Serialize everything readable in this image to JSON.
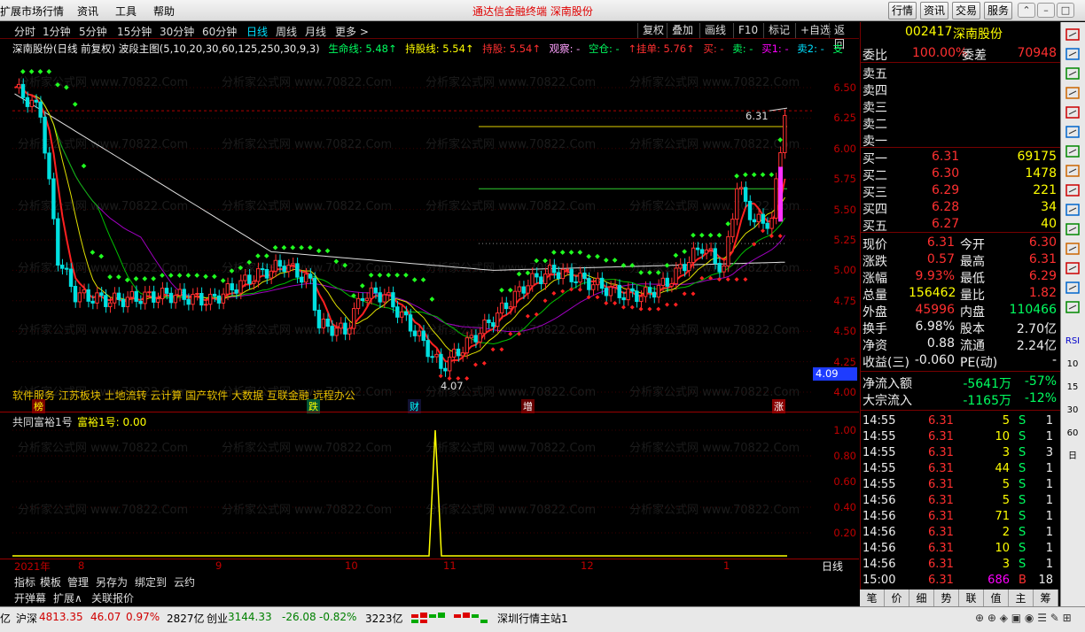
{
  "menu": {
    "items": [
      "扩展市场行情",
      "资讯",
      "工具",
      "帮助"
    ],
    "title": "通达信金融终端   深南股份",
    "right_buttons": [
      "行情",
      "资讯",
      "交易",
      "服务"
    ]
  },
  "period_bar": {
    "periods": [
      "分时",
      "1分钟",
      "5分钟",
      "15分钟",
      "30分钟",
      "60分钟",
      "日线",
      "周线",
      "月线",
      "更多 >"
    ],
    "active": "日线",
    "tools": [
      "复权",
      "叠加",
      "画线",
      "F10",
      "标记",
      "+自选",
      "返回"
    ]
  },
  "indicator_line": {
    "name": "深南股份(日线 前复权) 波段主图(5,10,20,30,60,125,250,30,9,3)",
    "life": "生命线: 5.48↑",
    "hold": "持股线: 5.54↑",
    "stop": "持股: 5.54↑",
    "watch": "观察: -",
    "empty": "空仓: -",
    "order": "↑挂单: 5.76↑",
    "buy": "买: -",
    "sell": "卖: -",
    "buy1": "买1: -",
    "sell2": "卖2: -",
    "support": "支"
  },
  "price_axis": {
    "labels": [
      "6.50",
      "6.25",
      "6.00",
      "5.75",
      "5.50",
      "5.25",
      "5.00",
      "4.75",
      "4.50",
      "4.25",
      "4.00"
    ],
    "current_tag": "4.09"
  },
  "annotations": {
    "high_label": "6.31",
    "low_label": "4.07",
    "concepts": "软件服务 江苏板块 土地流转 云计算 国产软件 大数据 互联金融 远程办公",
    "markers": [
      "榜",
      "跌",
      "财",
      "增",
      "涨"
    ]
  },
  "sub_chart": {
    "title": "共同富裕1号",
    "value": "富裕1号: 0.00",
    "y_labels": [
      "1.00",
      "0.80",
      "0.60",
      "0.40",
      "0.20"
    ]
  },
  "date_axis": {
    "labels": [
      "2021年",
      "8",
      "9",
      "10",
      "11",
      "12",
      "1"
    ],
    "period_label": "日线"
  },
  "bottom_tabs": [
    "指标",
    "模板",
    "管理",
    "另存为",
    "绑定到",
    "云约"
  ],
  "bottom_tabs2": [
    "开弹幕",
    "扩展∧",
    "关联报价"
  ],
  "stock": {
    "code": "002417",
    "name": "深南股份",
    "weibi_label": "委比",
    "weibi": "100.00%",
    "weicha_label": "委差",
    "weicha": "70948",
    "sell_levels": [
      {
        "label": "卖五",
        "price": "",
        "vol": ""
      },
      {
        "label": "卖四",
        "price": "",
        "vol": ""
      },
      {
        "label": "卖三",
        "price": "",
        "vol": ""
      },
      {
        "label": "卖二",
        "price": "",
        "vol": ""
      },
      {
        "label": "卖一",
        "price": "",
        "vol": ""
      }
    ],
    "buy_levels": [
      {
        "label": "买一",
        "price": "6.31",
        "vol": "69175"
      },
      {
        "label": "买二",
        "price": "6.30",
        "vol": "1478"
      },
      {
        "label": "买三",
        "price": "6.29",
        "vol": "221"
      },
      {
        "label": "买四",
        "price": "6.28",
        "vol": "34"
      },
      {
        "label": "买五",
        "price": "6.27",
        "vol": "40"
      }
    ],
    "stats": [
      {
        "l1": "现价",
        "v1": "6.31",
        "c1": "red",
        "l2": "今开",
        "v2": "6.30",
        "c2": "red"
      },
      {
        "l1": "涨跌",
        "v1": "0.57",
        "c1": "red",
        "l2": "最高",
        "v2": "6.31",
        "c2": "red"
      },
      {
        "l1": "涨幅",
        "v1": "9.93%",
        "c1": "red",
        "l2": "最低",
        "v2": "6.29",
        "c2": "red"
      },
      {
        "l1": "总量",
        "v1": "156462",
        "c1": "yellow",
        "l2": "量比",
        "v2": "1.82",
        "c2": "red"
      },
      {
        "l1": "外盘",
        "v1": "45996",
        "c1": "red",
        "l2": "内盘",
        "v2": "110466",
        "c2": "green"
      },
      {
        "l1": "换手",
        "v1": "6.98%",
        "c1": "white",
        "l2": "股本",
        "v2": "2.70亿",
        "c2": "white"
      },
      {
        "l1": "净资",
        "v1": "0.88",
        "c1": "white",
        "l2": "流通",
        "v2": "2.24亿",
        "c2": "white"
      },
      {
        "l1": "收益(三)",
        "v1": "-0.060",
        "c1": "white",
        "l2": "PE(动)",
        "v2": "-",
        "c2": "white"
      }
    ],
    "flow": [
      {
        "label": "净流入额",
        "v1": "-5641万",
        "v2": "-57%"
      },
      {
        "label": "大宗流入",
        "v1": "-1165万",
        "v2": "-12%"
      }
    ]
  },
  "ticks": [
    {
      "t": "14:55",
      "p": "6.31",
      "v": "5",
      "s": "S",
      "n": "1"
    },
    {
      "t": "14:55",
      "p": "6.31",
      "v": "10",
      "s": "S",
      "n": "1"
    },
    {
      "t": "14:55",
      "p": "6.31",
      "v": "3",
      "s": "S",
      "n": "3"
    },
    {
      "t": "14:55",
      "p": "6.31",
      "v": "44",
      "s": "S",
      "n": "1"
    },
    {
      "t": "14:55",
      "p": "6.31",
      "v": "5",
      "s": "S",
      "n": "1"
    },
    {
      "t": "14:56",
      "p": "6.31",
      "v": "5",
      "s": "S",
      "n": "1"
    },
    {
      "t": "14:56",
      "p": "6.31",
      "v": "71",
      "s": "S",
      "n": "1"
    },
    {
      "t": "14:56",
      "p": "6.31",
      "v": "2",
      "s": "S",
      "n": "1"
    },
    {
      "t": "14:56",
      "p": "6.31",
      "v": "10",
      "s": "S",
      "n": "1"
    },
    {
      "t": "14:56",
      "p": "6.31",
      "v": "3",
      "s": "S",
      "n": "1"
    },
    {
      "t": "15:00",
      "p": "6.31",
      "v": "686",
      "s": "B",
      "n": "18"
    }
  ],
  "right_tabs": [
    "笔",
    "价",
    "细",
    "势",
    "联",
    "值",
    "主",
    "筹"
  ],
  "side_labels": [
    "RSI",
    "10",
    "15",
    "30",
    "60",
    "日"
  ],
  "status": {
    "index1_name": "沪深",
    "index1_val": "4813.35",
    "index1_chg": "46.07",
    "index1_pct": "0.97%",
    "index1_amt": "2827亿",
    "index2_name": "创业",
    "index2_val": "3144.33",
    "index2_chg": "-26.08",
    "index2_pct": "-0.82%",
    "index2_amt": "3223亿",
    "server": "深圳行情主站1",
    "left_unit": "亿"
  },
  "watermark": "分析家公式网 www.70822.Com"
}
